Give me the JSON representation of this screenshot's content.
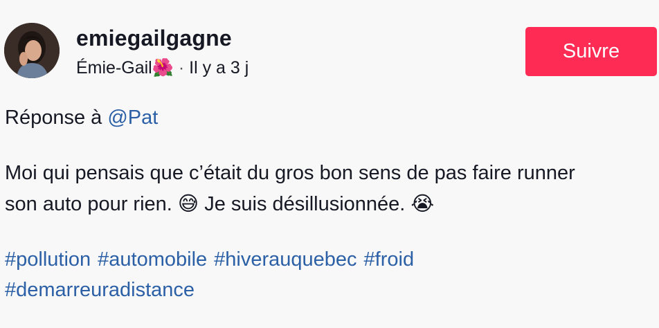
{
  "author": {
    "username": "emiegailgagne",
    "display_name": "Émie-Gail",
    "name_emoji": "🌺",
    "separator": "·",
    "time_ago": "Il y a 3 j"
  },
  "follow_button": {
    "label": "Suivre"
  },
  "post": {
    "reply_prefix": "Réponse à",
    "reply_mention": "@Pat",
    "body_line1": "Moi qui pensais que c’était du gros bon sens de pas faire runner",
    "body_line2_before_emoji": "son auto pour rien.",
    "emoji_1": "😅",
    "body_line2_after_emoji": "Je suis désillusionnée.",
    "emoji_2": "😭",
    "hashtags": [
      "#pollution",
      "#automobile",
      "#hiverauquebec",
      "#froid",
      "#demarreuradistance"
    ]
  },
  "colors": {
    "follow_button_bg": "#fe2c55",
    "link": "#2b5fa6",
    "text": "#161823",
    "background": "#f8f8f8"
  }
}
